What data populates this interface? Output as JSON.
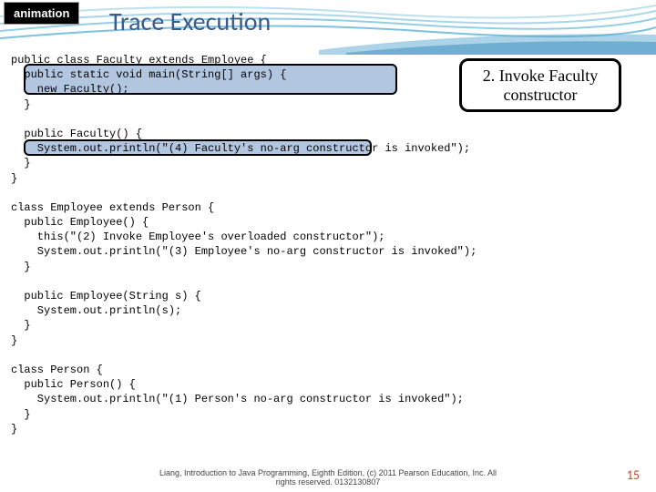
{
  "tag": "animation",
  "title": "Trace Execution",
  "callout": "2. Invoke Faculty constructor",
  "code": "public class Faculty extends Employee {\n  public static void main(String[] args) {\n    new Faculty();\n  }\n\n  public Faculty() {\n    System.out.println(\"(4) Faculty's no-arg constructor is invoked\");\n  }\n}\n\nclass Employee extends Person {\n  public Employee() {\n    this(\"(2) Invoke Employee's overloaded constructor\");\n    System.out.println(\"(3) Employee's no-arg constructor is invoked\");\n  }\n\n  public Employee(String s) {\n    System.out.println(s);\n  }\n}\n\nclass Person {\n  public Person() {\n    System.out.println(\"(1) Person's no-arg constructor is invoked\");\n  }\n}",
  "footer_line1": "Liang, Introduction to Java Programming, Eighth Edition, (c) 2011 Pearson Education, Inc. All",
  "footer_line2": "rights reserved. 0132130807",
  "page": "15"
}
